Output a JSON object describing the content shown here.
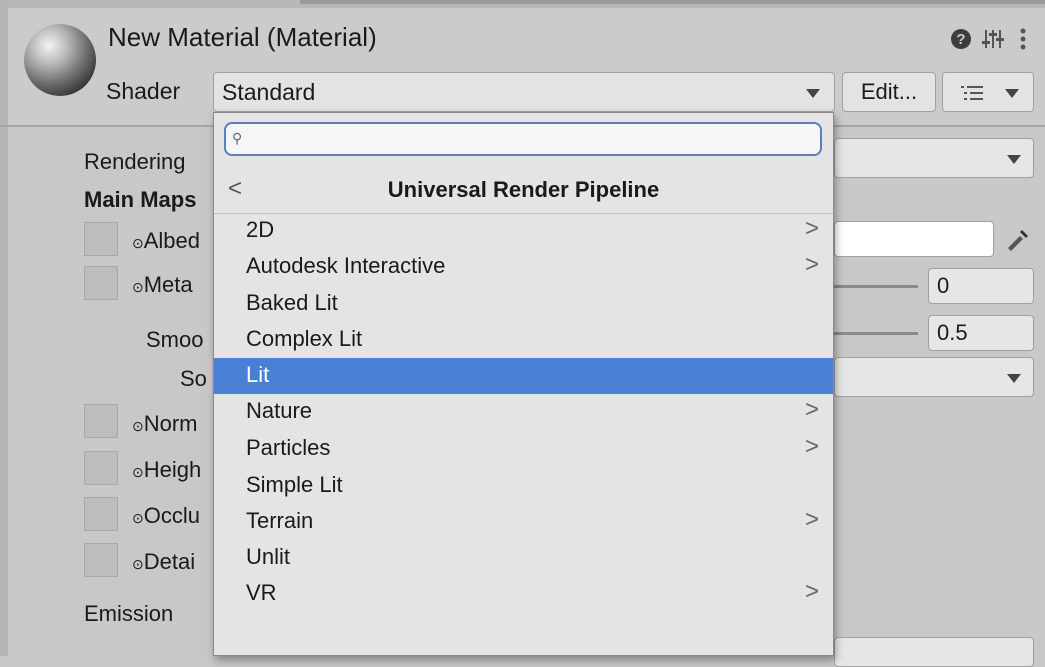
{
  "header": {
    "title": "New Material (Material)",
    "shader_label": "Shader",
    "shader_value": "Standard",
    "edit_label": "Edit...",
    "help_icon": "?",
    "settings_icon": "⚙",
    "more_icon": "⋮"
  },
  "properties": {
    "rendering": "Rendering",
    "main_maps": "Main Maps",
    "albedo": "Albed",
    "metallic": "Meta",
    "smoothness": "Smoo",
    "source": "So",
    "normal": "Norm",
    "height": "Heigh",
    "occlusion": "Occlu",
    "detail": "Detai",
    "emission": "Emission",
    "metallic_value": "0",
    "smoothness_value": "0.5"
  },
  "popup": {
    "search_placeholder": "",
    "title": "Universal Render Pipeline",
    "back_icon": "<",
    "items": [
      {
        "label": "2D",
        "submenu": ">"
      },
      {
        "label": "Autodesk Interactive",
        "submenu": ">"
      },
      {
        "label": "Baked Lit",
        "submenu": ""
      },
      {
        "label": "Complex Lit",
        "submenu": ""
      },
      {
        "label": "Lit",
        "submenu": ""
      },
      {
        "label": "Nature",
        "submenu": ">"
      },
      {
        "label": "Particles",
        "submenu": ">"
      },
      {
        "label": "Simple Lit",
        "submenu": ""
      },
      {
        "label": "Terrain",
        "submenu": ">"
      },
      {
        "label": "Unlit",
        "submenu": ""
      },
      {
        "label": "VR",
        "submenu": ">"
      }
    ],
    "selected_index": 4
  },
  "colors": {
    "selection": "#4a7fd6",
    "search_border": "#5b7fb8"
  }
}
